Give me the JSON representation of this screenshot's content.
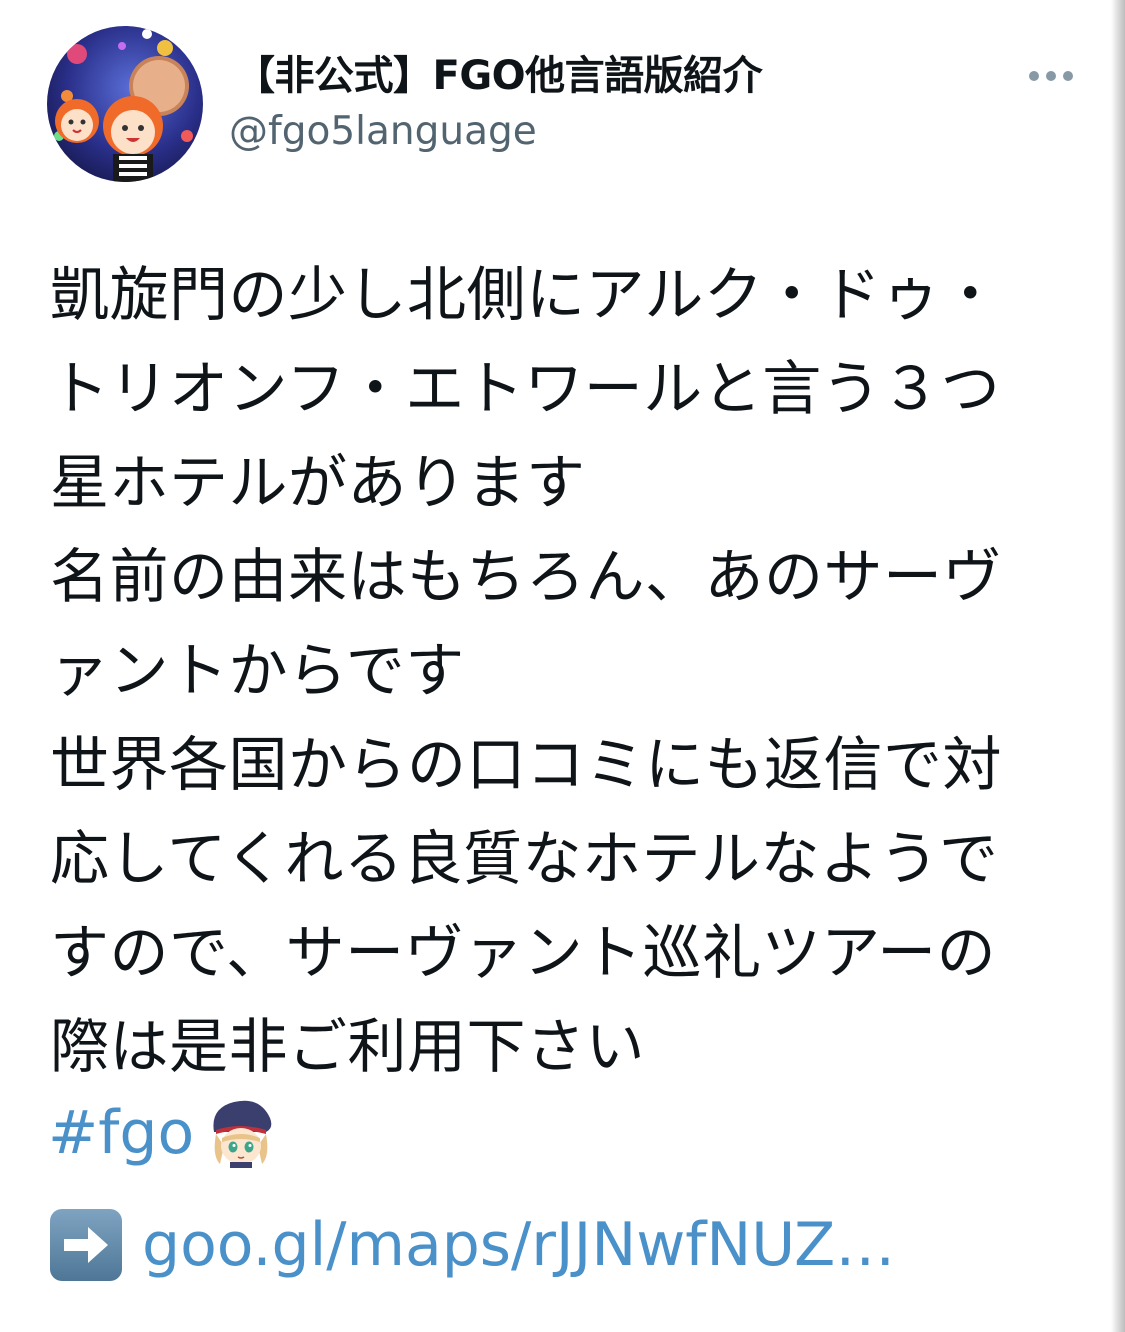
{
  "author": {
    "display_name": "【非公式】FGO他言語版紹介",
    "handle": "@fgo5language"
  },
  "tweet": {
    "lines": [
      "凱旋門の少し北側にアルク・ドゥ・",
      "トリオンフ・エトワールと言う３つ",
      "星ホテルがあります",
      "名前の由来はもちろん、あのサーヴ",
      "ァントからです",
      "世界各国からの口コミにも返信で対",
      "応してくれる良質なホテルなようで",
      "すので、サーヴァント巡礼ツアーの",
      "際は是非ご利用下さい"
    ],
    "hashtag": "#fgo",
    "link": "goo.gl/maps/rJJNwfNUZ…"
  },
  "icons": {
    "more": "more-horizontal-icon",
    "emoji": "character-emoji-icon",
    "arrow": "right-arrow-emoji-icon"
  },
  "colors": {
    "link": "#4a90c9",
    "handle": "#536471",
    "text": "#0f1419"
  }
}
